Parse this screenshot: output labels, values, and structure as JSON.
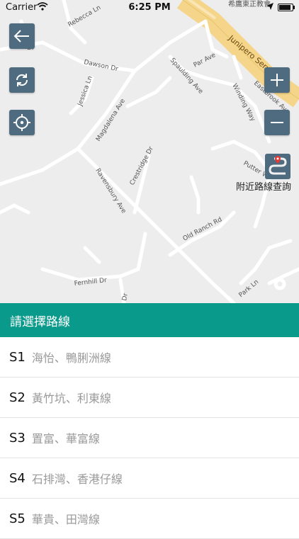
{
  "status_bar": {
    "carrier": "Carrier",
    "time": "6:25 PM",
    "battery_level": 0.95
  },
  "map": {
    "street_labels": {
      "rebecca": "Rebecca Ln",
      "dawson": "Dawson Dr",
      "jessica": "Jessica Ln",
      "magdalena": "Magdalena Ave",
      "ravensbury": "Ravensbury Ave",
      "crestridge": "Crestridge Dr",
      "spaulding": "Spaulding Ave",
      "par": "Par Ave",
      "winding": "Winding Way",
      "eastbrook": "Eastbrook Ave",
      "junipero": "Junipero Serra Fwy",
      "putter": "Putter W",
      "old_ranch": "Old Ranch Rd",
      "fernhill": "Fernhill Dr",
      "park": "Park Ln",
      "dr_fragment": "Dr",
      "ln_fragment": "Ln",
      "top_poi": "希鷹東正教會"
    }
  },
  "controls": {
    "back_icon": "arrow-left-icon",
    "refresh_icon": "refresh-icon",
    "locate_icon": "crosshair-icon",
    "zoom_in_icon": "plus-icon",
    "zoom_out_icon": "minus-icon",
    "nearby_icon": "route-map-icon",
    "nearby_label": "附近路線查詢"
  },
  "list": {
    "header": "請選擇路線",
    "routes": [
      {
        "code": "S1",
        "name": "海怡、鴨脷洲線"
      },
      {
        "code": "S2",
        "name": "黃竹坑、利東線"
      },
      {
        "code": "S3",
        "name": "置富、華富線"
      },
      {
        "code": "S4",
        "name": "石排灣、香港仔線"
      },
      {
        "code": "S5",
        "name": "華貴、田灣線"
      }
    ]
  },
  "colors": {
    "header_bg": "#0a9a8c",
    "button_bg": "#4e6b7f",
    "highway": "#f4d58a",
    "map_bg": "#ededed"
  }
}
